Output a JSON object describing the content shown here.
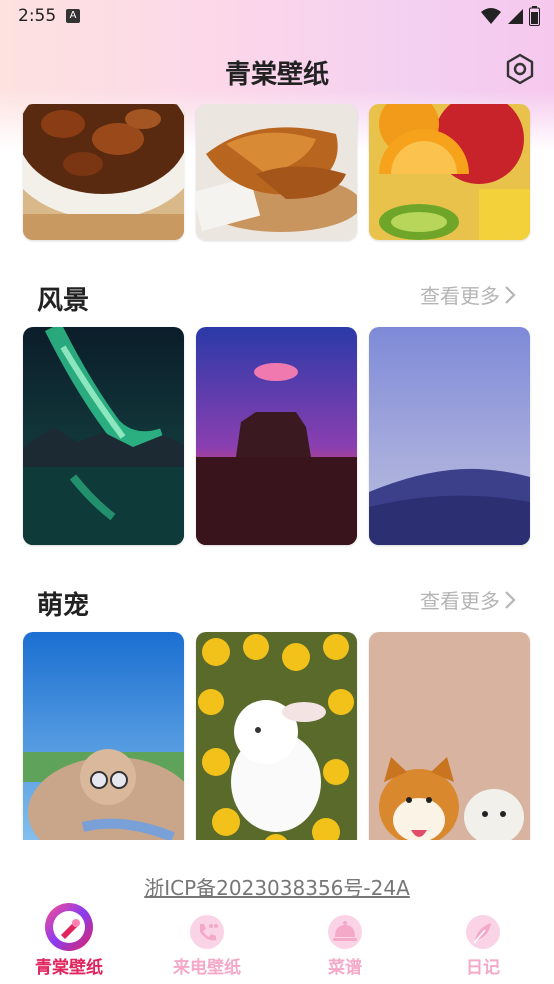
{
  "status_bar": {
    "time": "2:55",
    "a_badge": "A"
  },
  "header": {
    "title": "青棠壁纸"
  },
  "sections": [
    {
      "title": "风景",
      "more": "查看更多"
    },
    {
      "title": "萌宠",
      "more": "查看更多"
    }
  ],
  "icp": "浙ICP备2023038356号-24A",
  "nav": {
    "items": [
      {
        "label": "青棠壁纸",
        "active": true
      },
      {
        "label": "来电壁纸",
        "active": false
      },
      {
        "label": "菜谱",
        "active": false
      },
      {
        "label": "日记",
        "active": false
      }
    ],
    "active_color": "#e0245e",
    "inactive_color": "#f4a9c8"
  },
  "icons": [
    "settings-icon",
    "wifi-icon",
    "signal-icon",
    "battery-icon",
    "chevron-right-icon",
    "palette-icon",
    "phone-icon",
    "cloche-icon",
    "feather-icon"
  ]
}
